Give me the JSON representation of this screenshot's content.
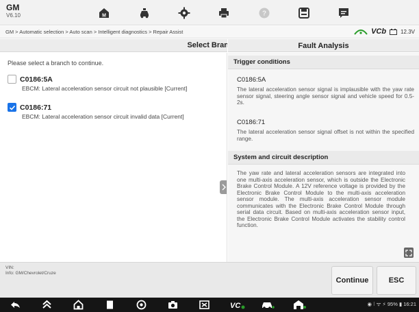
{
  "app": {
    "name": "GM",
    "version": "V6.10"
  },
  "toolbar": {
    "buttons": [
      "home-icon",
      "vehicle-icon",
      "settings-icon",
      "print-icon",
      "help-icon",
      "save-icon",
      "message-icon"
    ]
  },
  "breadcrumb": "GM > Automatic selection > Auto scan > Intelligent diagnostics > Repair Assist",
  "vci": {
    "label": "VCb",
    "voltage": "12.3V"
  },
  "left_header": "Select Bran",
  "right_header": "Fault Analysis",
  "instruction": "Please select a branch to continue.",
  "dtcs": [
    {
      "code": "C0186:5A",
      "description": "EBCM: Lateral acceleration sensor circuit not plausible [Current]",
      "checked": false
    },
    {
      "code": "C0186:71",
      "description": "EBCM: Lateral acceleration sensor circuit invalid data [Current]",
      "checked": true
    }
  ],
  "analysis": {
    "trigger_title": "Trigger conditions",
    "items": [
      {
        "code": "C0186:5A",
        "text": "The lateral acceleration sensor signal is implausible with the yaw rate sensor signal, steering angle sensor signal and vehicle speed for 0.5-2s."
      },
      {
        "code": "C0186:71",
        "text": "The lateral acceleration sensor signal offset is not within the specified range."
      }
    ],
    "system_title": "System and circuit description",
    "system_text": "The yaw rate and lateral acceleration sensors are integrated into one multi-axis acceleration sensor, which is outside the Electronic Brake Control Module. A 12V reference voltage is provided by the Electronic Brake Control Module to the multi-axis acceleration sensor module. The multi-axis acceleration sensor module communicates with the Electronic Brake Control Module through serial data circuit. Based on multi-axis acceleration sensor input, the Electronic Brake Control Module activates the stability control function."
  },
  "vehicle_info": {
    "vin_label": "VIN:",
    "info_label": "Info: GM/Chevrolet/Cruze"
  },
  "buttons": {
    "continue": "Continue",
    "esc": "ESC"
  },
  "status_bar": {
    "battery": "95%",
    "time": "16:21"
  },
  "colors": {
    "accent": "#1a73e8",
    "navbar": "#151515"
  }
}
